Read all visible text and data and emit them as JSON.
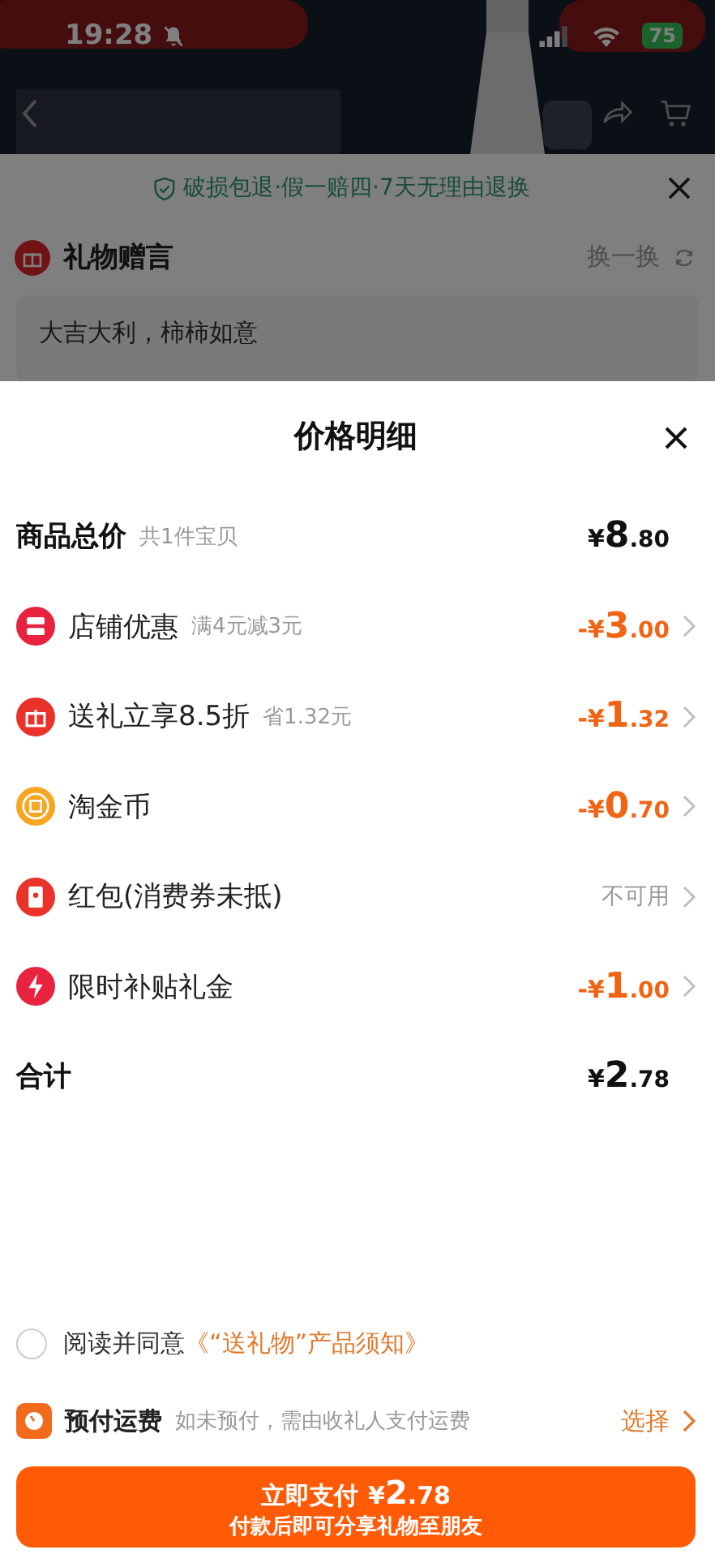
{
  "status_bar": {
    "time": "19:28",
    "battery": "75"
  },
  "background": {
    "guarantee": "破损包退·假一赔四·7天无理由退换",
    "gift_message": {
      "title": "礼物赠言",
      "refresh": "换一换",
      "message": "大吉大利，柿柿如意"
    }
  },
  "sheet": {
    "title": "价格明细",
    "subtotal": {
      "label": "商品总价",
      "note": "共1件宝贝",
      "amount": "¥8.80"
    },
    "rows": [
      {
        "kind": "discount",
        "label": "店铺优惠",
        "note": "满4元减3元",
        "amount": "-¥3.00"
      },
      {
        "kind": "discount",
        "label": "送礼立享8.5折",
        "note": "省1.32元",
        "amount": "-¥1.32"
      },
      {
        "kind": "discount",
        "label": "淘金币",
        "amount": "-¥0.70"
      },
      {
        "kind": "unavailable",
        "label": "红包(消费券未抵)",
        "amount": "不可用"
      },
      {
        "kind": "discount",
        "label": "限时补贴礼金",
        "amount": "-¥1.00"
      }
    ],
    "total": {
      "label": "合计",
      "amount": "¥2.78"
    }
  },
  "agreement": {
    "checked": false,
    "text": "阅读并同意",
    "link": "《“送礼物”产品须知》"
  },
  "prepay": {
    "title": "预付运费",
    "note": "如未预付，需由收礼人支付运费",
    "action": "选择"
  },
  "pay_button": {
    "label": "立即支付",
    "amount": "¥2.78",
    "subtitle": "付款后即可分享礼物至朋友"
  }
}
